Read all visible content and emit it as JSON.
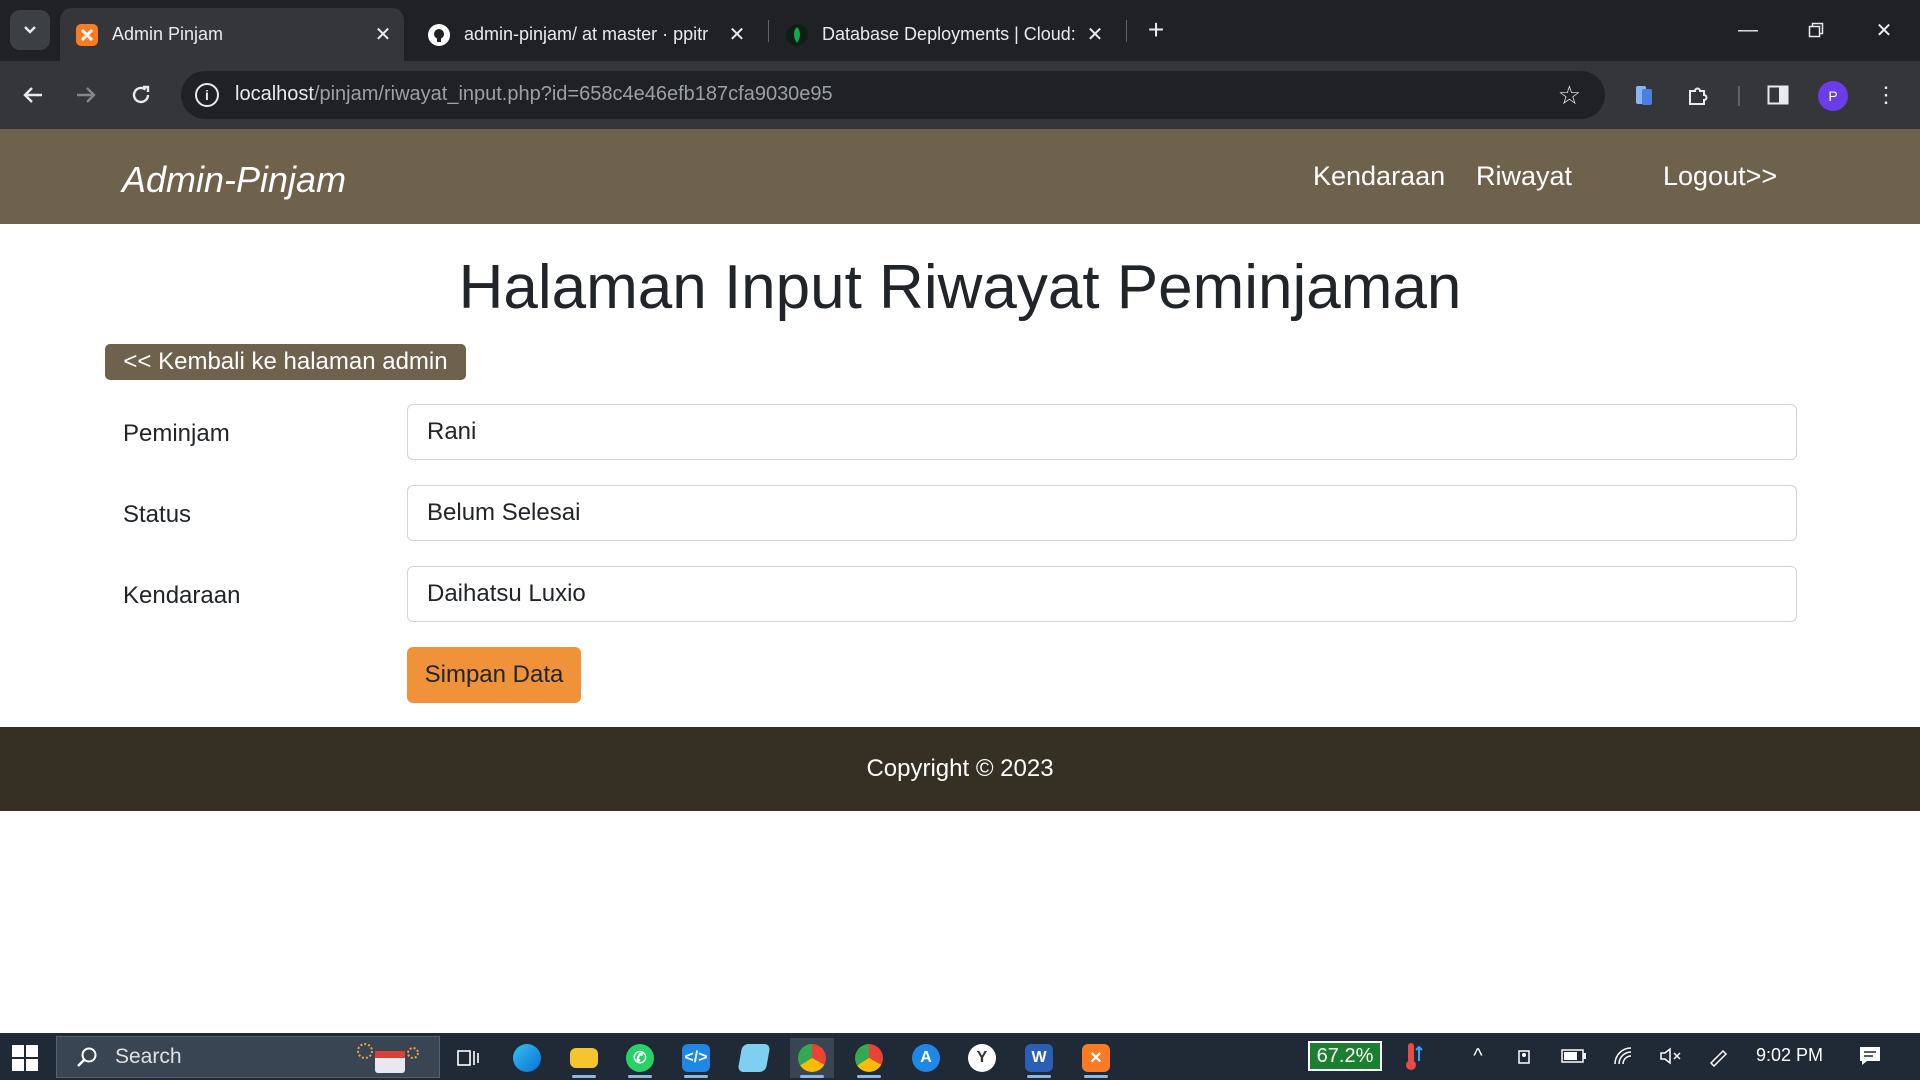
{
  "browser": {
    "tabs": [
      {
        "title": "Admin Pinjam",
        "favicon": "xampp-icon",
        "active": true
      },
      {
        "title": "admin-pinjam/ at master · ppitr",
        "favicon": "github-icon",
        "active": false
      },
      {
        "title": "Database Deployments | Cloud:",
        "favicon": "mongodb-leaf-icon",
        "active": false
      }
    ],
    "url_host": "localhost",
    "url_path": "/pinjam/riwayat_input.php?id=658c4e46efb187cfa9030e95",
    "profile_initial": "P"
  },
  "site": {
    "brand": "Admin-Pinjam",
    "nav": {
      "kendaraan": "Kendaraan",
      "riwayat": "Riwayat",
      "logout": "Logout>>"
    },
    "page_title": "Halaman Input Riwayat Peminjaman",
    "back_button": "<< Kembali ke halaman admin",
    "form": {
      "peminjam_label": "Peminjam",
      "peminjam_value": "Rani",
      "status_label": "Status",
      "status_value": "Belum Selesai",
      "kendaraan_label": "Kendaraan",
      "kendaraan_value": "Daihatsu Luxio",
      "submit_label": "Simpan Data"
    },
    "footer": "Copyright © 2023"
  },
  "taskbar": {
    "search_placeholder": "Search",
    "battery_widget": "67.2%",
    "time": "9:02 PM"
  },
  "colors": {
    "navbar": "#6e624c",
    "footer": "#362f23",
    "save_button": "#f0923a"
  }
}
